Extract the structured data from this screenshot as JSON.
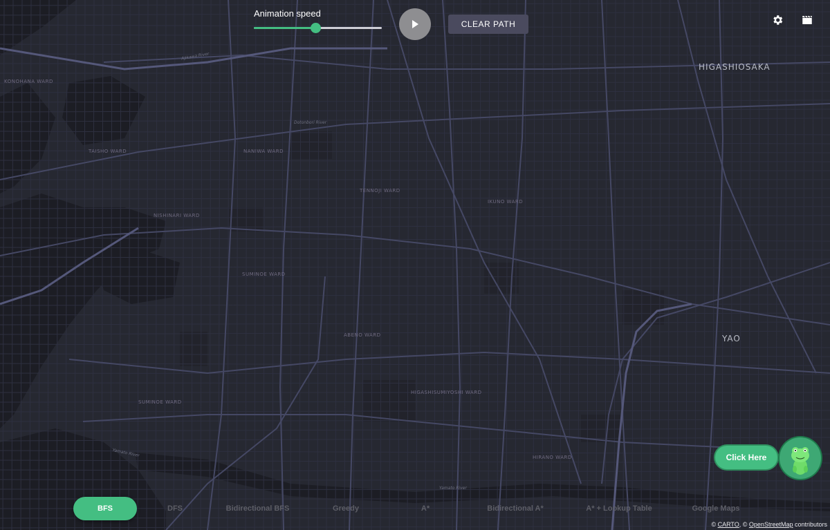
{
  "map": {
    "labels": {
      "konohana": "KONOHANA WARD",
      "higashiosaka": "HIGASHIOSAKA",
      "yao": "YAO",
      "naniwa": "NANIWA WARD",
      "tennoji": "TENNOJI WARD",
      "ikuno": "IKUNO WARD",
      "abeno": "ABENO WARD",
      "sumida": "SUMINOE WARD",
      "higashisumiyoshi": "HIGASHISUMIYOSHI WARD",
      "hirano": "HIRANO WARD",
      "taisho": "TAISHO WARD",
      "nishinari": "NISHINARI WARD",
      "suminoe2": "SUMINOE WARD",
      "yamato_river_1": "Yamato River",
      "yamato_river_2": "Yamato River",
      "aji_river": "Ajikawa River",
      "dotonbori": "Dotonbori River"
    }
  },
  "controls": {
    "speed_label": "Animation speed",
    "speed_value": 0.48,
    "clear_label": "CLEAR PATH"
  },
  "algorithms": [
    {
      "label": "BFS",
      "active": true
    },
    {
      "label": "DFS",
      "active": false
    },
    {
      "label": "Bidirectional BFS",
      "active": false
    },
    {
      "label": "Greedy",
      "active": false
    },
    {
      "label": "A*",
      "active": false
    },
    {
      "label": "Bidirectional A*",
      "active": false
    },
    {
      "label": "A* + Lookup Table",
      "active": false
    },
    {
      "label": "Google Maps",
      "active": false
    }
  ],
  "help": {
    "label": "Click Here"
  },
  "attribution": {
    "prefix": "© ",
    "carto": "CARTO",
    "middle": ", © ",
    "osm": "OpenStreetMap",
    "suffix": " contributors"
  },
  "colors": {
    "accent": "#44be82",
    "background": "#262831",
    "water": "#1c1d24",
    "road": "#3d4054"
  },
  "icons": {
    "settings": "gear-icon",
    "film": "clapperboard-icon",
    "play": "play-icon"
  }
}
